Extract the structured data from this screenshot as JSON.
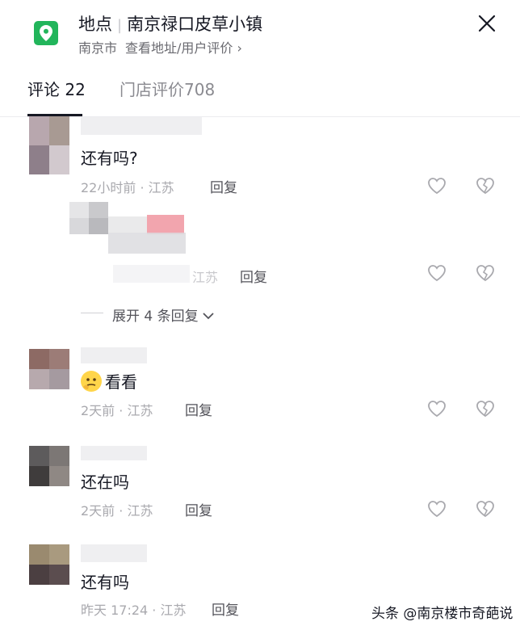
{
  "header": {
    "location_label": "地点",
    "place_name": "南京禄口皮草小镇",
    "city": "南京市",
    "detail_link": "查看地址/用户评价 ›",
    "close_icon": "close-icon"
  },
  "tabs": [
    {
      "label": "评论 22",
      "active": true
    },
    {
      "label": "门店评价708",
      "active": false
    }
  ],
  "comments": [
    {
      "text": "还有吗?",
      "meta": "22小时前 · 江苏",
      "reply": "回复"
    },
    {
      "text": "看看",
      "meta": "2天前 · 江苏",
      "reply": "回复",
      "emoji": "thinking-emoji"
    },
    {
      "text": "还在吗",
      "meta": "2天前 · 江苏",
      "reply": "回复"
    },
    {
      "text": "还有吗",
      "meta": "昨天 17:24 · 江苏",
      "reply": "回复"
    }
  ],
  "subreply": {
    "meta": "江苏",
    "reply": "回复"
  },
  "expand_replies": "展开 4 条回复",
  "watermark": "头条 @南京楼市奇葩说",
  "colors": {
    "accent_green": "#22b55b",
    "text": "#161823",
    "muted": "#a9a9ae"
  }
}
